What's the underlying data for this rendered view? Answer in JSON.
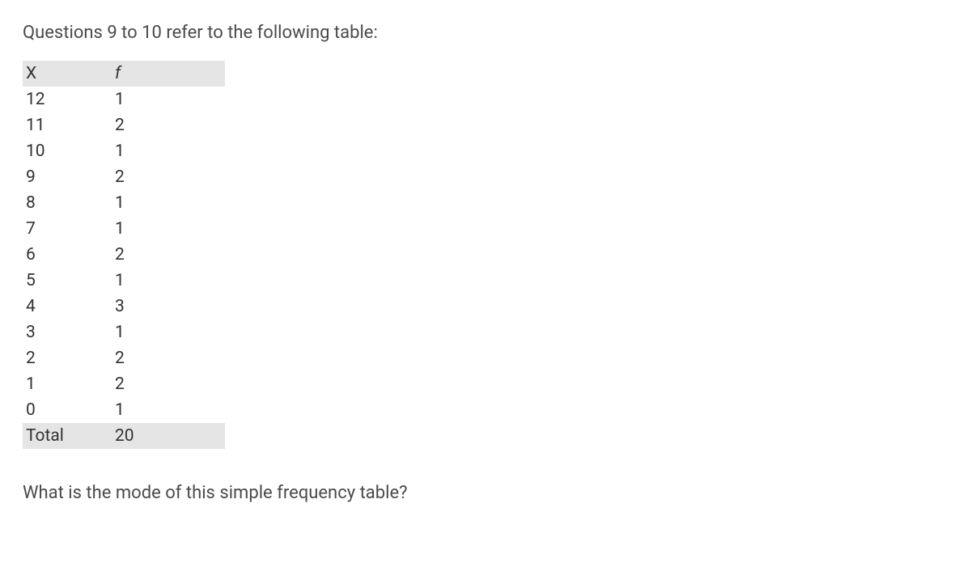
{
  "intro": "Questions 9 to 10 refer to the following table:",
  "table": {
    "headers": {
      "x": "X",
      "f": "f"
    },
    "rows": [
      {
        "x": "12",
        "f": "1"
      },
      {
        "x": "11",
        "f": "2"
      },
      {
        "x": "10",
        "f": "1"
      },
      {
        "x": "9",
        "f": "2"
      },
      {
        "x": "8",
        "f": "1"
      },
      {
        "x": "7",
        "f": "1"
      },
      {
        "x": "6",
        "f": "2"
      },
      {
        "x": "5",
        "f": "1"
      },
      {
        "x": "4",
        "f": "3"
      },
      {
        "x": "3",
        "f": "1"
      },
      {
        "x": "2",
        "f": "2"
      },
      {
        "x": "1",
        "f": "2"
      },
      {
        "x": "0",
        "f": "1"
      }
    ],
    "total": {
      "label": "Total",
      "value": "20"
    }
  },
  "question": "What is the mode of this simple frequency table?"
}
